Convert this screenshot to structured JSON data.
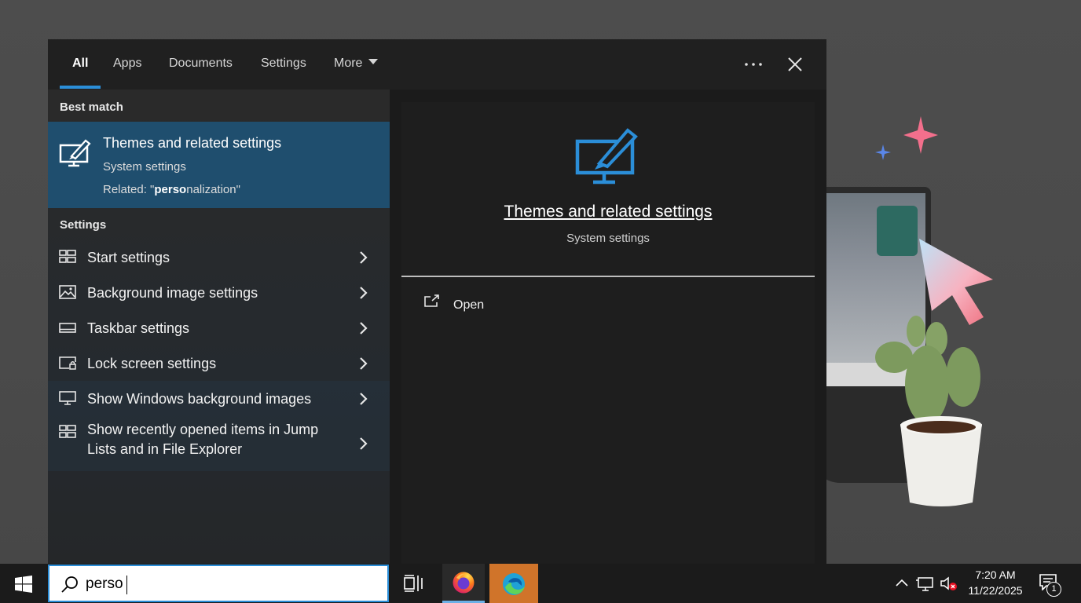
{
  "tabs": {
    "all": "All",
    "apps": "Apps",
    "documents": "Documents",
    "settings": "Settings",
    "more": "More"
  },
  "results": {
    "best_match_heading": "Best match",
    "best_match": {
      "title": "Themes and related settings",
      "subtitle": "System settings",
      "related_prefix": "Related: \"",
      "related_match": "perso",
      "related_rest": "nalization\""
    },
    "settings_heading": "Settings",
    "items": [
      {
        "label": "Start settings",
        "icon": "start-settings-icon"
      },
      {
        "label": "Background image settings",
        "icon": "image-icon"
      },
      {
        "label": "Taskbar settings",
        "icon": "taskbar-icon"
      },
      {
        "label": "Lock screen settings",
        "icon": "lock-screen-icon"
      },
      {
        "label": "Show Windows background images",
        "icon": "monitor-icon"
      },
      {
        "label": "Show recently opened items in Jump Lists and in File Explorer",
        "icon": "start-settings-icon"
      }
    ]
  },
  "preview": {
    "title": "Themes and related settings",
    "subtitle": "System settings",
    "open_label": "Open"
  },
  "taskbar": {
    "search_value": "perso",
    "clock_time": "7:20 AM",
    "clock_date": "11/22/2025",
    "notification_count": "1"
  },
  "colors": {
    "accent": "#2b8ed8",
    "selected_bg": "#1f4e6e",
    "flyout_bg": "#202020",
    "taskbar_bg": "#1b1b1b"
  }
}
